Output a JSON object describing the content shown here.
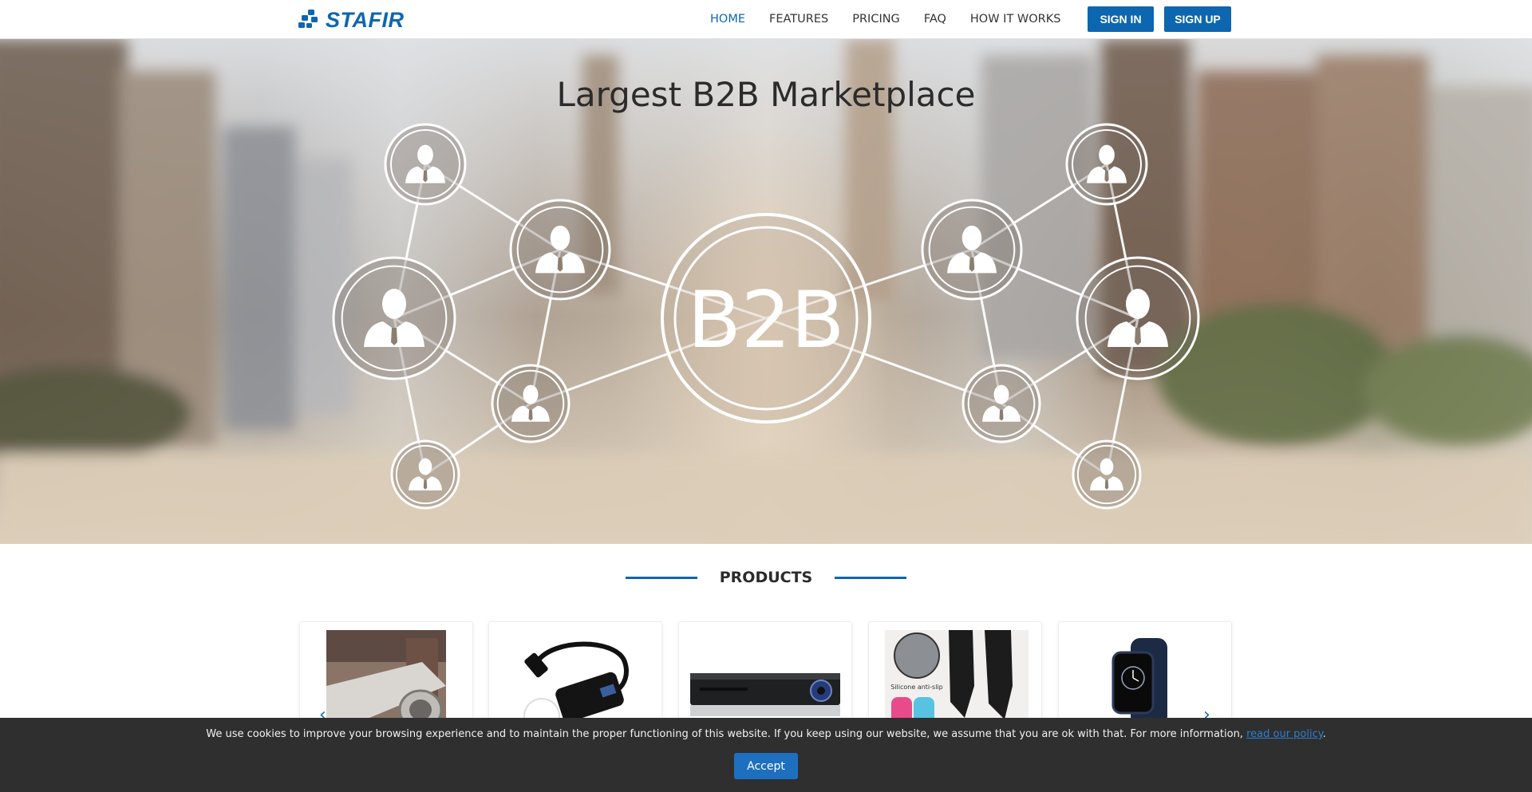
{
  "header": {
    "logo_text": "STAFIR",
    "nav": [
      {
        "label": "HOME",
        "active": true
      },
      {
        "label": "FEATURES",
        "active": false
      },
      {
        "label": "PRICING",
        "active": false
      },
      {
        "label": "FAQ",
        "active": false
      },
      {
        "label": "HOW IT WORKS",
        "active": false
      }
    ],
    "sign_in": "SIGN IN",
    "sign_up": "SIGN UP"
  },
  "hero": {
    "title": "Largest B2B Marketplace",
    "center_label": "B2B"
  },
  "products": {
    "title": "PRODUCTS",
    "cards": [
      {
        "image": "steel-pipe-image"
      },
      {
        "image": "usb-adapter-image"
      },
      {
        "image": "dvr-recorder-image"
      },
      {
        "image": "compression-socks-image",
        "caption": "Silicone anti-slip"
      },
      {
        "image": "smartwatch-image"
      }
    ]
  },
  "cookie": {
    "message": "We use cookies to improve your browsing experience and to maintain the proper functioning of this website. If you keep using our website, we assume that you are ok with that. For more information,",
    "link_text": "read our policy",
    "suffix": ".",
    "accept_label": "Accept"
  },
  "colors": {
    "brand": "#0d66b0",
    "cookie_bg": "#2f2f2f",
    "accept_bg": "#1e6fc0"
  }
}
